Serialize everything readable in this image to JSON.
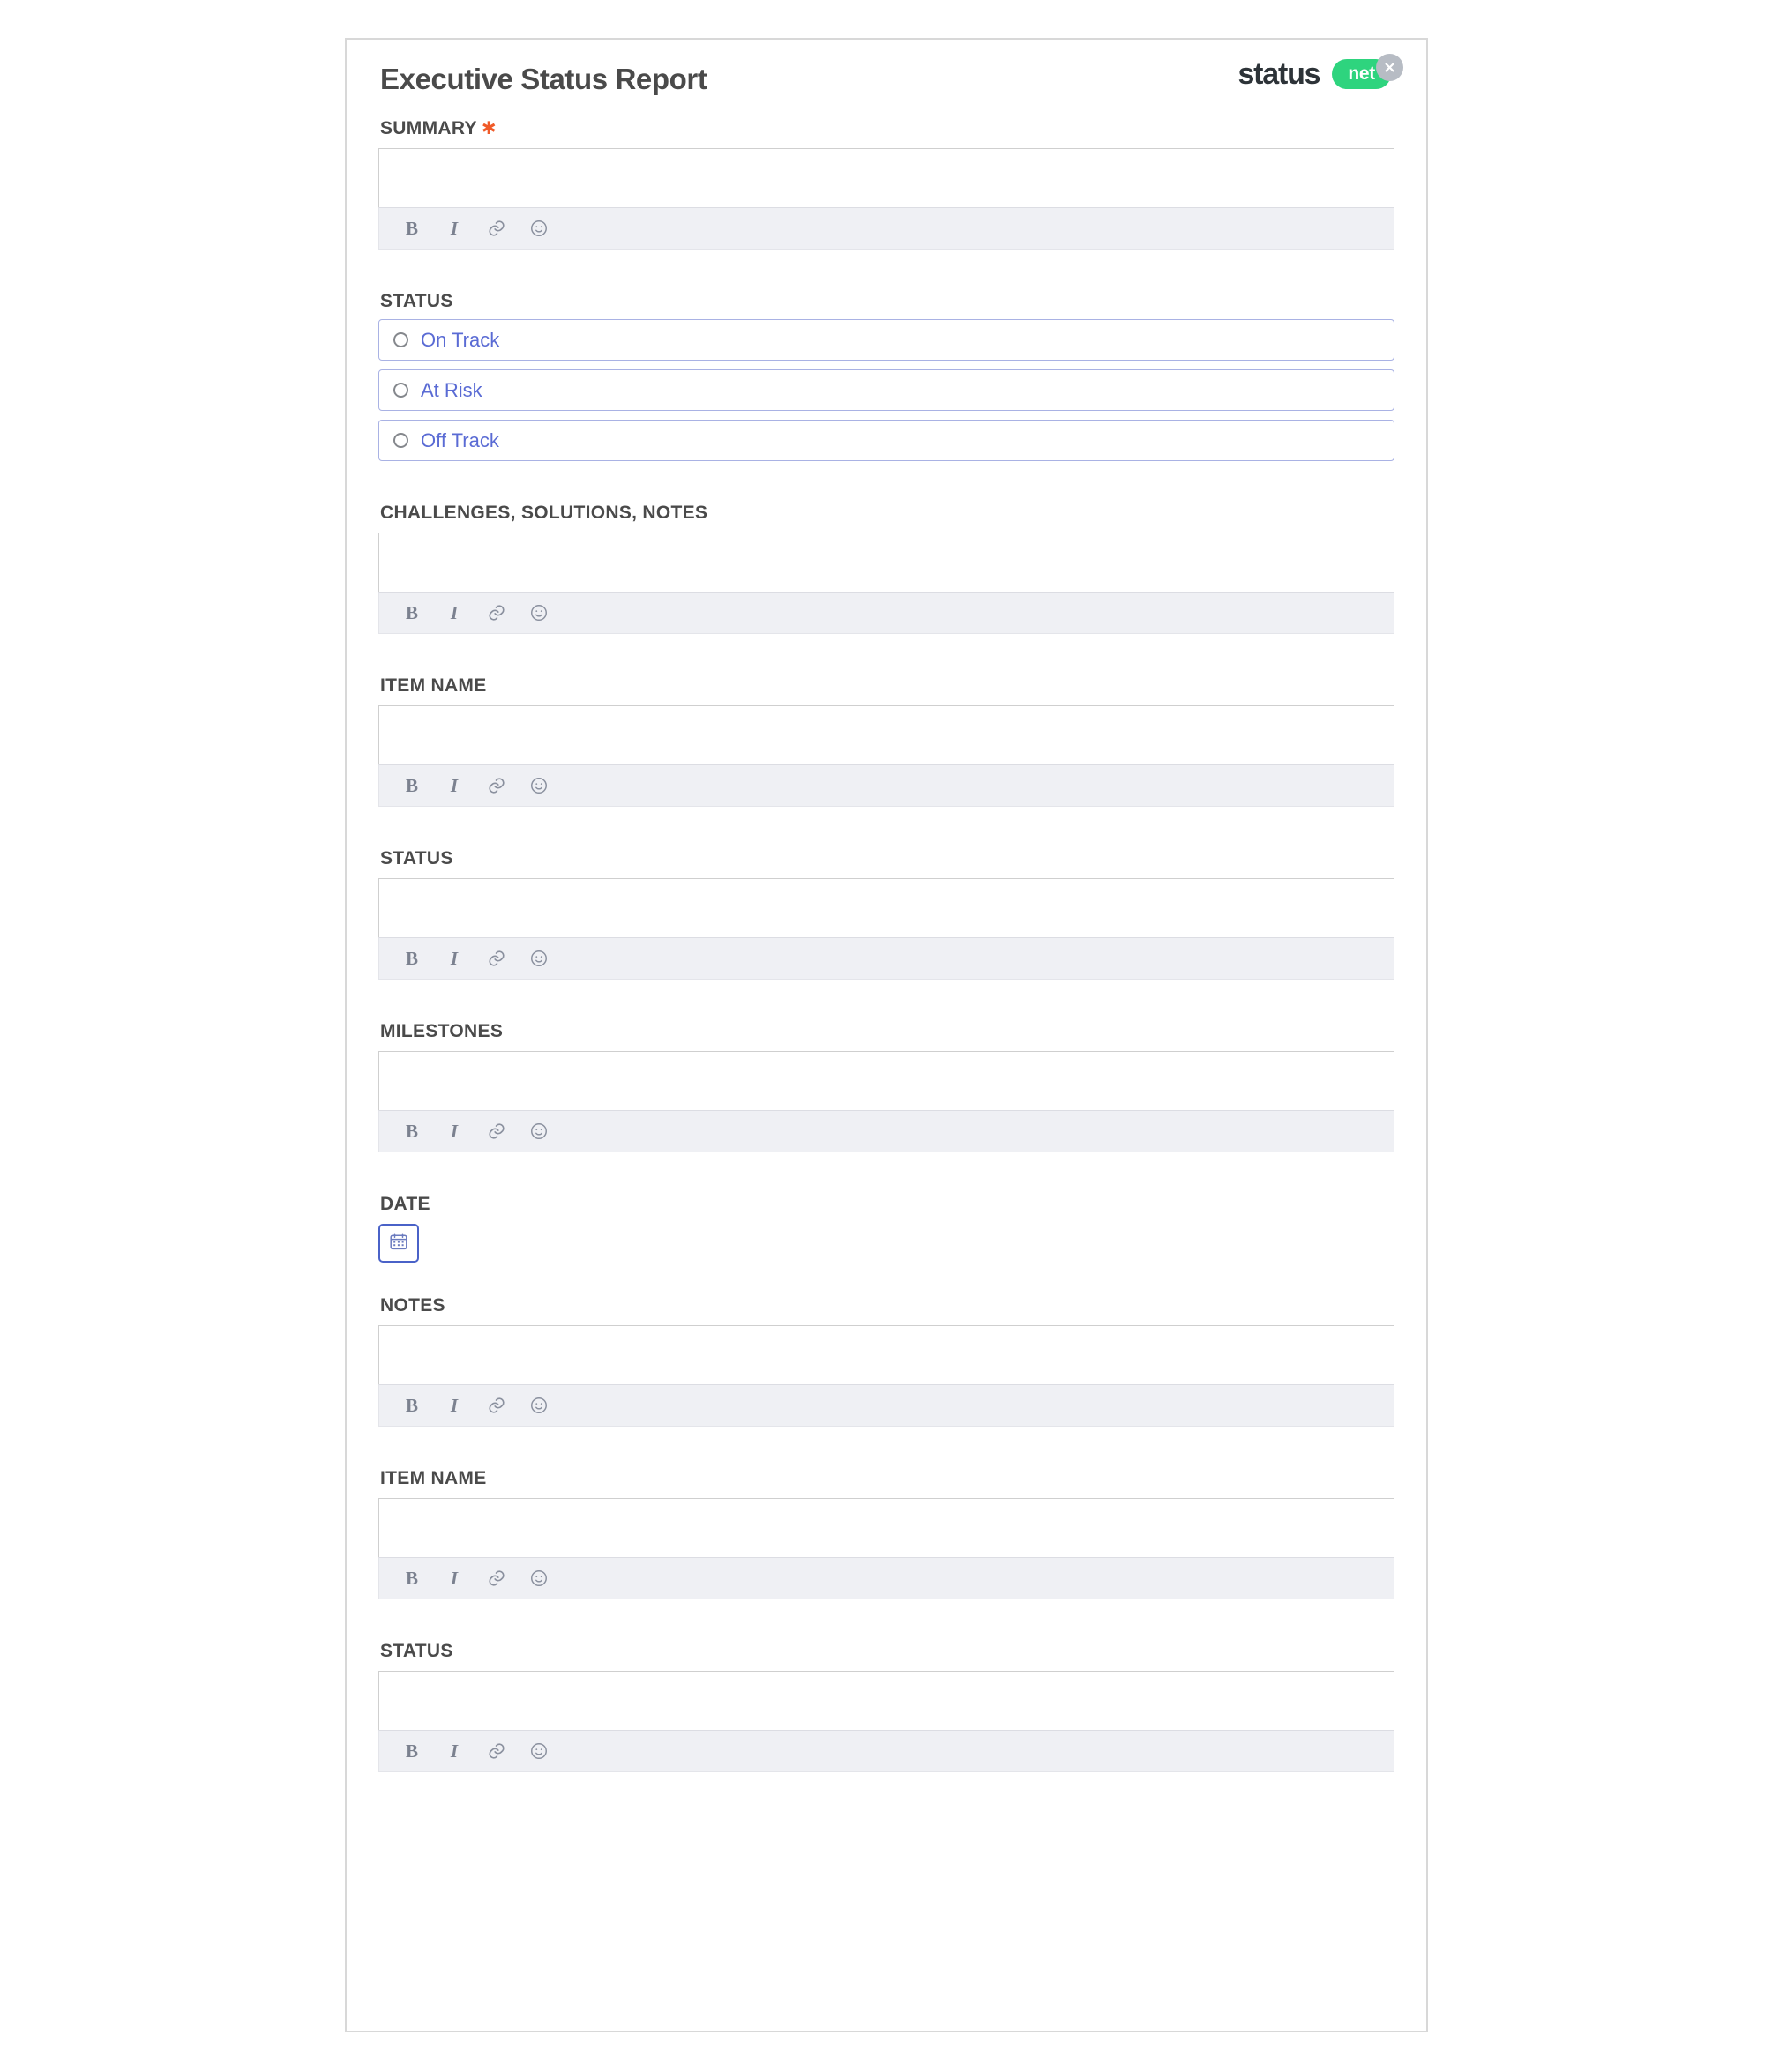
{
  "header": {
    "title": "Executive Status Report",
    "brand_word": "status",
    "brand_pill": "net",
    "close_label": "×"
  },
  "colors": {
    "accent_green": "#2ed47e",
    "required_star": "#f05a28",
    "radio_text": "#5a6bd4",
    "radio_border": "#a9b2e4",
    "label_text": "#4a4a4a",
    "toolbar_bg": "#eff0f4",
    "card_border": "#d8d8d8",
    "date_border": "#4a62c8"
  },
  "toolbar": {
    "bold_label": "B",
    "italic_label": "I",
    "link_name": "link-icon",
    "emoji_name": "emoji-icon"
  },
  "sections": [
    {
      "id": "summary",
      "label": "SUMMARY",
      "required": true,
      "type": "richtext",
      "value": ""
    },
    {
      "id": "status1",
      "label": "STATUS",
      "required": false,
      "type": "radio",
      "value": ""
    },
    {
      "id": "challenges",
      "label": "CHALLENGES, SOLUTIONS, NOTES",
      "required": false,
      "type": "richtext",
      "value": ""
    },
    {
      "id": "itemname1",
      "label": "ITEM NAME",
      "required": false,
      "type": "richtext",
      "value": ""
    },
    {
      "id": "status2",
      "label": "STATUS",
      "required": false,
      "type": "richtext",
      "value": ""
    },
    {
      "id": "milestones",
      "label": "MILESTONES",
      "required": false,
      "type": "richtext",
      "value": ""
    },
    {
      "id": "date",
      "label": "DATE",
      "required": false,
      "type": "date",
      "value": ""
    },
    {
      "id": "notes",
      "label": "NOTES",
      "required": false,
      "type": "richtext",
      "value": ""
    },
    {
      "id": "itemname2",
      "label": "ITEM NAME",
      "required": false,
      "type": "richtext",
      "value": ""
    },
    {
      "id": "status3",
      "label": "STATUS",
      "required": false,
      "type": "richtext",
      "value": ""
    }
  ],
  "status_options": [
    {
      "id": "on-track",
      "label": "On Track",
      "selected": false
    },
    {
      "id": "at-risk",
      "label": "At Risk",
      "selected": false
    },
    {
      "id": "off-track",
      "label": "Off Track",
      "selected": false
    }
  ],
  "date_field": {
    "icon_name": "calendar-icon",
    "value": ""
  }
}
